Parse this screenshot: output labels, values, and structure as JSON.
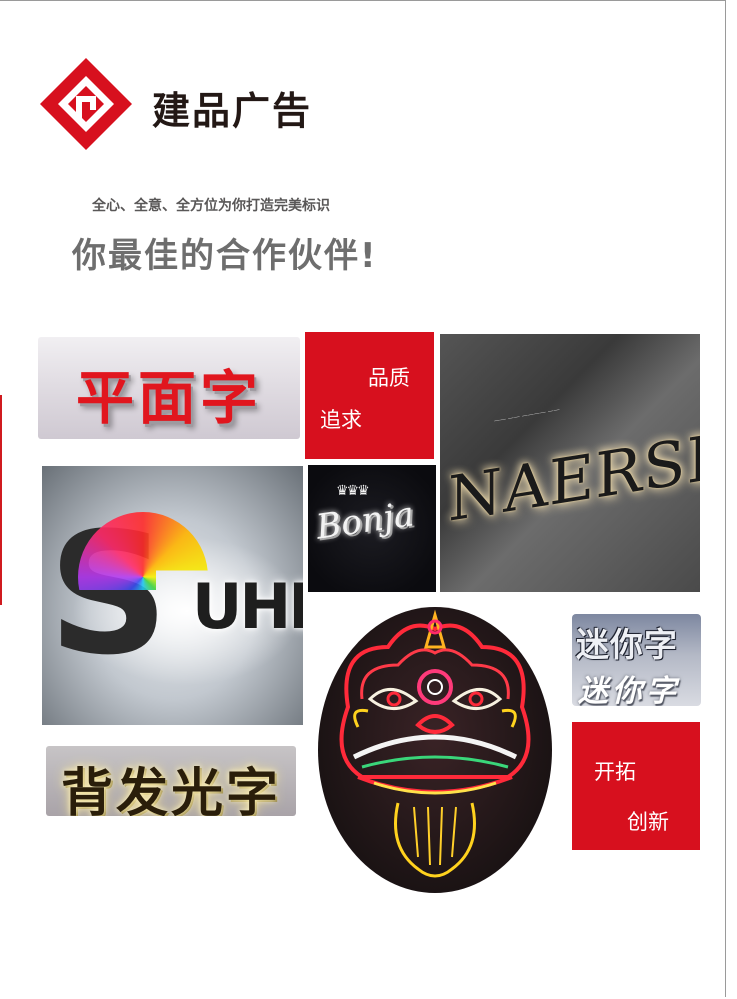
{
  "brand": {
    "name": "建品广告",
    "logo_glyph": "JP"
  },
  "header": {
    "tagline": "全心、全意、全方位为你打造完美标识",
    "headline": "你最佳的合作伙伴!"
  },
  "panels": {
    "quality": {
      "line1": "品质",
      "line2": "追求"
    },
    "innovate": {
      "line1": "开拓",
      "line2": "创新"
    }
  },
  "signs": {
    "flat": "平面字",
    "naersi": "NAERSI",
    "naersi_caption": "—— —— ———— ——",
    "bonja": "Bonja",
    "bonja_crown": "♛♛♛",
    "suhd_s": "S",
    "suhd_rest": "UHD",
    "mini_top": "迷你字",
    "mini_bottom": "迷你字",
    "backlit": "背发光字"
  },
  "colors": {
    "brand_red": "#d7101e",
    "title_gray": "#6e6e6e"
  }
}
